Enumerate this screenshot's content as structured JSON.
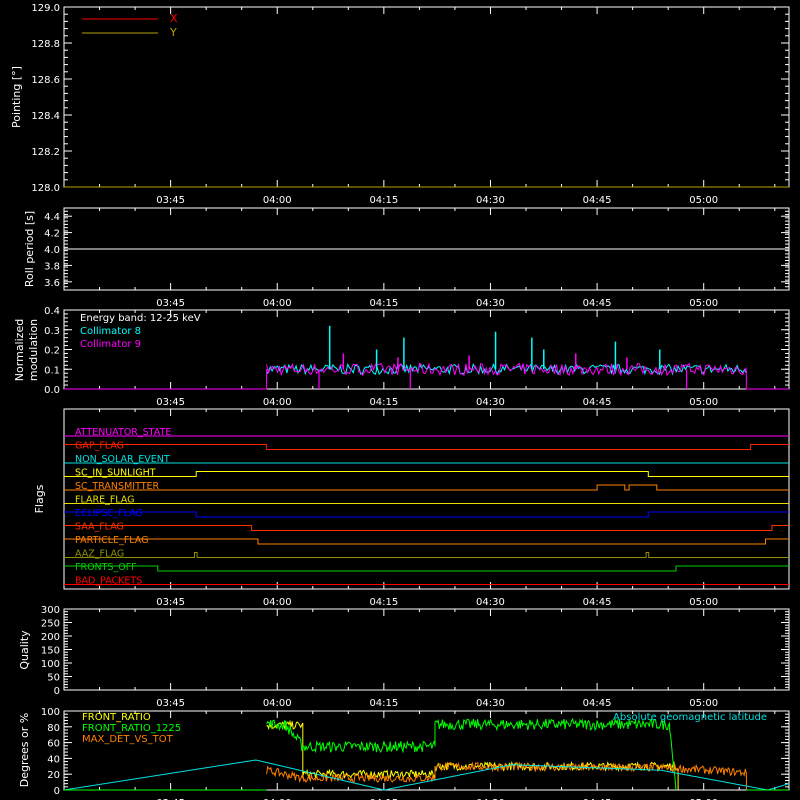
{
  "x_ticks": [
    "03:45",
    "04:00",
    "04:15",
    "04:30",
    "04:45",
    "05:00"
  ],
  "chart_data": [
    {
      "type": "line",
      "ylabel": "Pointing [°]",
      "ylim": [
        128.0,
        129.0
      ],
      "yticks": [
        "128.0",
        "128.2",
        "128.4",
        "128.6",
        "128.8",
        "129.0"
      ],
      "xlim_hours": [
        3.5,
        5.2
      ],
      "legend": [
        "X",
        "Y"
      ],
      "legend_placement": "top-left",
      "series": [
        {
          "name": "X",
          "color": "#ff0000",
          "x": [
            3.5,
            5.2
          ],
          "values": [
            128.0,
            128.0
          ]
        },
        {
          "name": "Y",
          "color": "#b8a000",
          "x": [
            3.5,
            5.2
          ],
          "values": [
            128.0,
            128.0
          ]
        }
      ]
    },
    {
      "type": "line",
      "ylabel": "Roll period [s]",
      "ylim": [
        3.5,
        4.5
      ],
      "yticks": [
        "3.6",
        "3.8",
        "4.0",
        "4.2",
        "4.4"
      ],
      "series": [
        {
          "color": "#ffffff",
          "x": [
            3.5,
            5.2
          ],
          "values": [
            4.0,
            4.0
          ]
        }
      ]
    },
    {
      "type": "line",
      "ylabel_lines": [
        "Normalized",
        "modulation"
      ],
      "ylim": [
        0.0,
        0.4
      ],
      "yticks": [
        "0.0",
        "0.1",
        "0.2",
        "0.3",
        "0.4"
      ],
      "legend_title": "Energy band: 12-25 keV",
      "legend": [
        "Collimator 8",
        "Collimator 9"
      ],
      "legend_placement": "top-left",
      "active_range_hours": [
        3.975,
        5.1
      ],
      "base_level": 0.1,
      "series": [
        {
          "name": "Collimator 8",
          "color": "#00ffff",
          "spikes_x": [
            4.123,
            4.233,
            4.297,
            4.512,
            4.597,
            4.625,
            4.793,
            4.897
          ],
          "spikes_y": [
            0.32,
            0.2,
            0.26,
            0.29,
            0.26,
            0.2,
            0.24,
            0.2
          ]
        },
        {
          "name": "Collimator 9",
          "color": "#ff00ff",
          "dropouts_x": [
            4.098,
            4.312,
            4.96
          ],
          "spikes_x": [
            4.155,
            4.283,
            4.45,
            4.7,
            4.82
          ],
          "spikes_y": [
            0.18,
            0.16,
            0.17,
            0.18,
            0.16
          ]
        }
      ]
    },
    {
      "type": "line",
      "ylabel": "Flags",
      "flags": [
        {
          "name": "ATTENUATOR_STATE",
          "color": "#ff00ff",
          "highs": []
        },
        {
          "name": "GAP_FLAG",
          "color": "#ff2000",
          "highs": [
            [
              3.5,
              3.975
            ],
            [
              5.11,
              5.2
            ]
          ]
        },
        {
          "name": "NON_SOLAR_EVENT",
          "color": "#00e0e0",
          "highs": []
        },
        {
          "name": "SC_IN_SUNLIGHT",
          "color": "#ffff00",
          "highs": [
            [
              3.81,
              4.87
            ]
          ]
        },
        {
          "name": "SC_TRANSMITTER",
          "color": "#ff8000",
          "highs": [
            [
              4.75,
              4.815
            ],
            [
              4.825,
              4.89
            ]
          ]
        },
        {
          "name": "FLARE_FLAG",
          "color": "#e8e000",
          "highs": []
        },
        {
          "name": "ECLIPSE_FLAG",
          "color": "#0000ff",
          "highs": [
            [
              3.5,
              3.81
            ],
            [
              4.87,
              5.2
            ]
          ]
        },
        {
          "name": "SAA_FLAG",
          "color": "#ff3000",
          "highs": [
            [
              3.5,
              3.94
            ],
            [
              5.16,
              5.2
            ]
          ]
        },
        {
          "name": "PARTICLE_FLAG",
          "color": "#ff8000",
          "highs": [
            [
              3.5,
              3.955
            ],
            [
              5.145,
              5.2
            ]
          ]
        },
        {
          "name": "AAZ_FLAG",
          "color": "#909000",
          "highs": [
            [
              3.806,
              3.812
            ],
            [
              4.865,
              4.871
            ]
          ]
        },
        {
          "name": "FRONTS_OFF",
          "color": "#00d000",
          "highs": [
            [
              3.5,
              3.72
            ],
            [
              4.935,
              5.2
            ]
          ]
        },
        {
          "name": "BAD_PACKETS",
          "color": "#ff0000",
          "highs": []
        }
      ]
    },
    {
      "type": "line",
      "ylabel": "Quality",
      "ylim": [
        0,
        300
      ],
      "yticks": [
        "0",
        "50",
        "100",
        "150",
        "200",
        "250",
        "300"
      ],
      "series": [
        {
          "color": "#ffffff",
          "x": [
            3.5,
            5.2
          ],
          "values": [
            0,
            0
          ]
        }
      ]
    },
    {
      "type": "line",
      "ylabel": "Degrees or %",
      "ylim": [
        0,
        100
      ],
      "yticks": [
        "0",
        "20",
        "40",
        "60",
        "80",
        "100"
      ],
      "legend": [
        "FRONT_RATIO",
        "FRONT_RATIO_1225",
        "MAX_DET_VS_TOT"
      ],
      "legend_placement": "top-left",
      "annotation": "Absolute geomagnetic latitude",
      "active_range_hours": [
        3.975,
        5.1
      ],
      "series": [
        {
          "name": "FRONT_RATIO",
          "color": "#ffff00",
          "x": [
            3.975,
            4.06,
            4.06,
            4.37,
            4.37,
            4.94
          ],
          "values": [
            82,
            82,
            20,
            20,
            30,
            30
          ]
        },
        {
          "name": "FRONT_RATIO_1225",
          "color": "#00ff00",
          "x": [
            3.975,
            4.02,
            4.06,
            4.37,
            4.37,
            4.92,
            4.935
          ],
          "values": [
            84,
            82,
            55,
            55,
            83,
            83,
            0
          ]
        },
        {
          "name": "MAX_DET_VS_TOT",
          "color": "#ff8000",
          "x": [
            3.975,
            4.06,
            4.37,
            4.37,
            4.92,
            5.1
          ],
          "values": [
            25,
            15,
            15,
            30,
            28,
            22
          ]
        },
        {
          "name": "Absolute geomagnetic latitude",
          "color": "#00e0e0",
          "x": [
            3.5,
            3.95,
            4.25,
            4.55,
            4.9,
            5.15,
            5.2
          ],
          "values": [
            0,
            38,
            0,
            32,
            25,
            0,
            8
          ]
        }
      ]
    }
  ]
}
